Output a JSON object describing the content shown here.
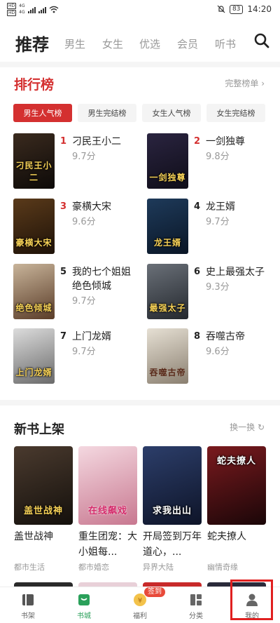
{
  "status_bar": {
    "sim1": "HD",
    "sim2": "HD",
    "net1": "4G",
    "net2": "4G",
    "battery": "83",
    "time": "14:20"
  },
  "top_tabs": [
    "推荐",
    "男生",
    "女生",
    "优选",
    "会员",
    "听书"
  ],
  "ranking": {
    "title": "排行榜",
    "more": "完整榜单",
    "segments": [
      "男生人气榜",
      "男生完结榜",
      "女生人气榜",
      "女生完结榜"
    ],
    "items": [
      {
        "rank": "1",
        "name": "刁民王小二",
        "score": "9.7分",
        "cover_text": "刁民王小二",
        "cover_colors": [
          "#3a2a1e",
          "#0d0a08"
        ]
      },
      {
        "rank": "2",
        "name": "一剑独尊",
        "score": "9.8分",
        "cover_text": "一剑独尊",
        "cover_colors": [
          "#2a2440",
          "#0f0d18"
        ]
      },
      {
        "rank": "3",
        "name": "豪横大宋",
        "score": "9.6分",
        "cover_text": "豪横大宋",
        "cover_colors": [
          "#5a3a1a",
          "#1e1208"
        ]
      },
      {
        "rank": "4",
        "name": "龙王婿",
        "score": "9.7分",
        "cover_text": "龙王婿",
        "cover_colors": [
          "#1e3a5a",
          "#0a1626"
        ]
      },
      {
        "rank": "5",
        "name": "我的七个姐姐绝色倾城",
        "score": "9.7分",
        "cover_text": "绝色倾城",
        "cover_colors": [
          "#c8b49a",
          "#5a3c28"
        ]
      },
      {
        "rank": "6",
        "name": "史上最强太子",
        "score": "9.3分",
        "cover_text": "最强太子",
        "cover_colors": [
          "#6a7078",
          "#24282e"
        ]
      },
      {
        "rank": "7",
        "name": "上门龙婿",
        "score": "9.7分",
        "cover_text": "上门龙婿",
        "cover_colors": [
          "#dcdcdc",
          "#6a6a6a"
        ]
      },
      {
        "rank": "8",
        "name": "吞噬古帝",
        "score": "9.6分",
        "cover_text": "吞噬古帝",
        "cover_colors": [
          "#e6e0d4",
          "#8a7f70"
        ]
      }
    ]
  },
  "new_books": {
    "title": "新书上架",
    "refresh": "换一换",
    "items": [
      {
        "name": "盖世战神",
        "genre": "都市生活",
        "cover_text": "盖世战神",
        "cover_colors": [
          "#4a3a2e",
          "#14100c"
        ]
      },
      {
        "name": "重生团宠：大小姐每...",
        "genre": "都市婚恋",
        "cover_text": "在线飙戏",
        "cover_colors": [
          "#f4d8e0",
          "#c87890"
        ]
      },
      {
        "name": "开局签到万年道心，...",
        "genre": "异界大陆",
        "cover_text": "求我出山",
        "cover_colors": [
          "#2c3e6a",
          "#0e1428"
        ]
      },
      {
        "name": "蛇夫撩人",
        "genre": "幽情奇缘",
        "cover_text": "蛇夫撩人",
        "cover_colors": [
          "#7a1a1e",
          "#1a0608"
        ]
      }
    ]
  },
  "bottom_nav": {
    "items": [
      "书架",
      "书城",
      "福利",
      "分类",
      "我的"
    ],
    "welfare_badge": "签到",
    "active_color": "#2aa05a"
  },
  "colors": {
    "accent": "#d43030",
    "highlight_frame": "#e02020"
  }
}
